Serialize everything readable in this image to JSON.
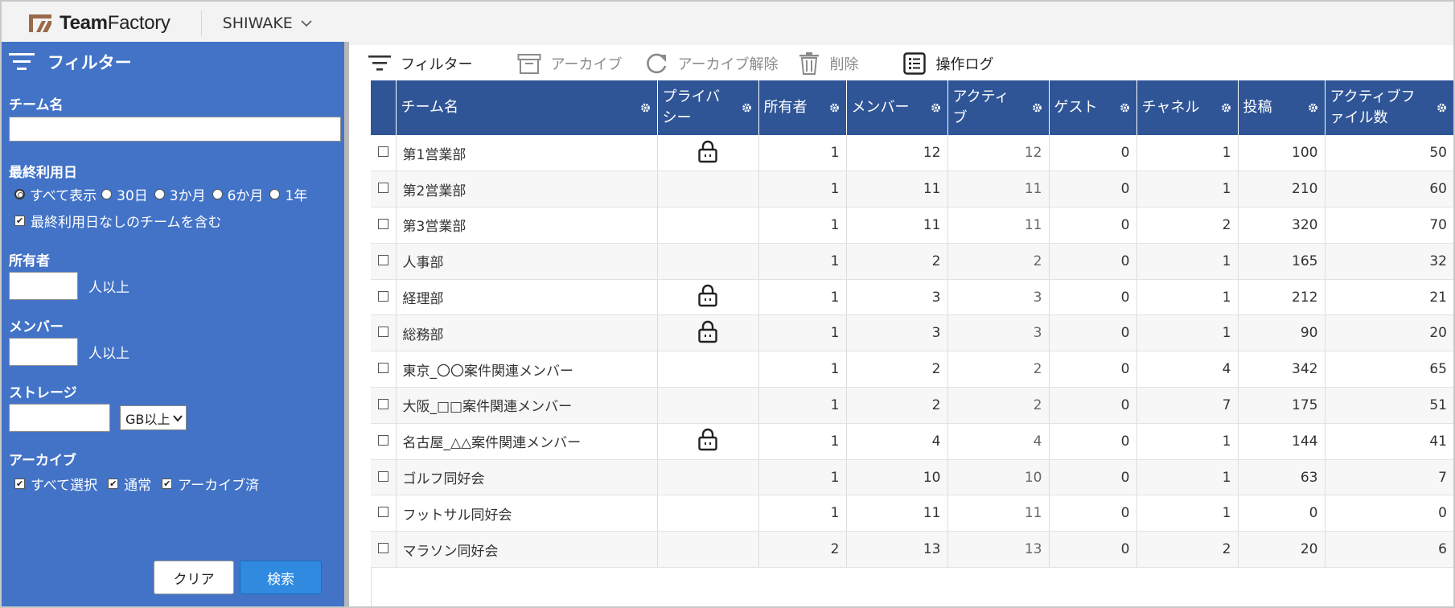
{
  "brand": {
    "name_bold": "Team",
    "name_regular": "Factory"
  },
  "app_selector": {
    "label": "SHIWAKE"
  },
  "sidebar": {
    "title": "フィルター",
    "team_name": {
      "label": "チーム名",
      "value": ""
    },
    "last_used": {
      "label": "最終利用日",
      "options": [
        "すべて表示",
        "30日",
        "3か月",
        "6か月",
        "1年"
      ],
      "selected": "すべて表示",
      "include_none_label": "最終利用日なしのチームを含む",
      "include_none_checked": true
    },
    "owners": {
      "label": "所有者",
      "value": "",
      "suffix": "人以上"
    },
    "members": {
      "label": "メンバー",
      "value": "",
      "suffix": "人以上"
    },
    "storage": {
      "label": "ストレージ",
      "value": "",
      "unit_selected": "GB以上"
    },
    "archive": {
      "label": "アーカイブ",
      "options": [
        {
          "label": "すべて選択",
          "checked": true
        },
        {
          "label": "通常",
          "checked": true
        },
        {
          "label": "アーカイブ済",
          "checked": true
        }
      ]
    },
    "clear_label": "クリア",
    "search_label": "検索"
  },
  "toolbar": {
    "filter_label": "フィルター",
    "archive_label": "アーカイブ",
    "unarchive_label": "アーカイブ解除",
    "delete_label": "削除",
    "log_label": "操作ログ"
  },
  "table": {
    "headers": {
      "team_name": "チーム名",
      "privacy_1": "プライバ",
      "privacy_2": "シー",
      "owners": "所有者",
      "members": "メンバー",
      "active_1": "アクティ",
      "active_2": "ブ",
      "guests": "ゲスト",
      "channels": "チャネル",
      "posts": "投稿",
      "active_files_1": "アクティブフ",
      "active_files_2": "ァイル数"
    },
    "rows": [
      {
        "name": "第1営業部",
        "private": true,
        "owners": "1",
        "members": "12",
        "active": "12",
        "guests": "0",
        "channels": "1",
        "posts": "100",
        "files": "50"
      },
      {
        "name": "第2営業部",
        "private": false,
        "owners": "1",
        "members": "11",
        "active": "11",
        "guests": "0",
        "channels": "1",
        "posts": "210",
        "files": "60"
      },
      {
        "name": "第3営業部",
        "private": false,
        "owners": "1",
        "members": "11",
        "active": "11",
        "guests": "0",
        "channels": "2",
        "posts": "320",
        "files": "70"
      },
      {
        "name": "人事部",
        "private": false,
        "owners": "1",
        "members": "2",
        "active": "2",
        "guests": "0",
        "channels": "1",
        "posts": "165",
        "files": "32"
      },
      {
        "name": "経理部",
        "private": true,
        "owners": "1",
        "members": "3",
        "active": "3",
        "guests": "0",
        "channels": "1",
        "posts": "212",
        "files": "21"
      },
      {
        "name": "総務部",
        "private": true,
        "owners": "1",
        "members": "3",
        "active": "3",
        "guests": "0",
        "channels": "1",
        "posts": "90",
        "files": "20"
      },
      {
        "name": "東京_〇〇案件関連メンバー",
        "private": false,
        "owners": "1",
        "members": "2",
        "active": "2",
        "guests": "0",
        "channels": "4",
        "posts": "342",
        "files": "65"
      },
      {
        "name": "大阪_□□案件関連メンバー",
        "private": false,
        "owners": "1",
        "members": "2",
        "active": "2",
        "guests": "0",
        "channels": "7",
        "posts": "175",
        "files": "51"
      },
      {
        "name": "名古屋_△△案件関連メンバー",
        "private": true,
        "owners": "1",
        "members": "4",
        "active": "4",
        "guests": "0",
        "channels": "1",
        "posts": "144",
        "files": "41"
      },
      {
        "name": "ゴルフ同好会",
        "private": false,
        "owners": "1",
        "members": "10",
        "active": "10",
        "guests": "0",
        "channels": "1",
        "posts": "63",
        "files": "7"
      },
      {
        "name": "フットサル同好会",
        "private": false,
        "owners": "1",
        "members": "11",
        "active": "11",
        "guests": "0",
        "channels": "1",
        "posts": "0",
        "files": "0"
      },
      {
        "name": "マラソン同好会",
        "private": false,
        "owners": "2",
        "members": "13",
        "active": "13",
        "guests": "0",
        "channels": "2",
        "posts": "20",
        "files": "6"
      }
    ]
  },
  "colors": {
    "sidebar_bg": "#4273c7",
    "header_bg": "#2f5597",
    "search_button": "#2f8ae0"
  }
}
